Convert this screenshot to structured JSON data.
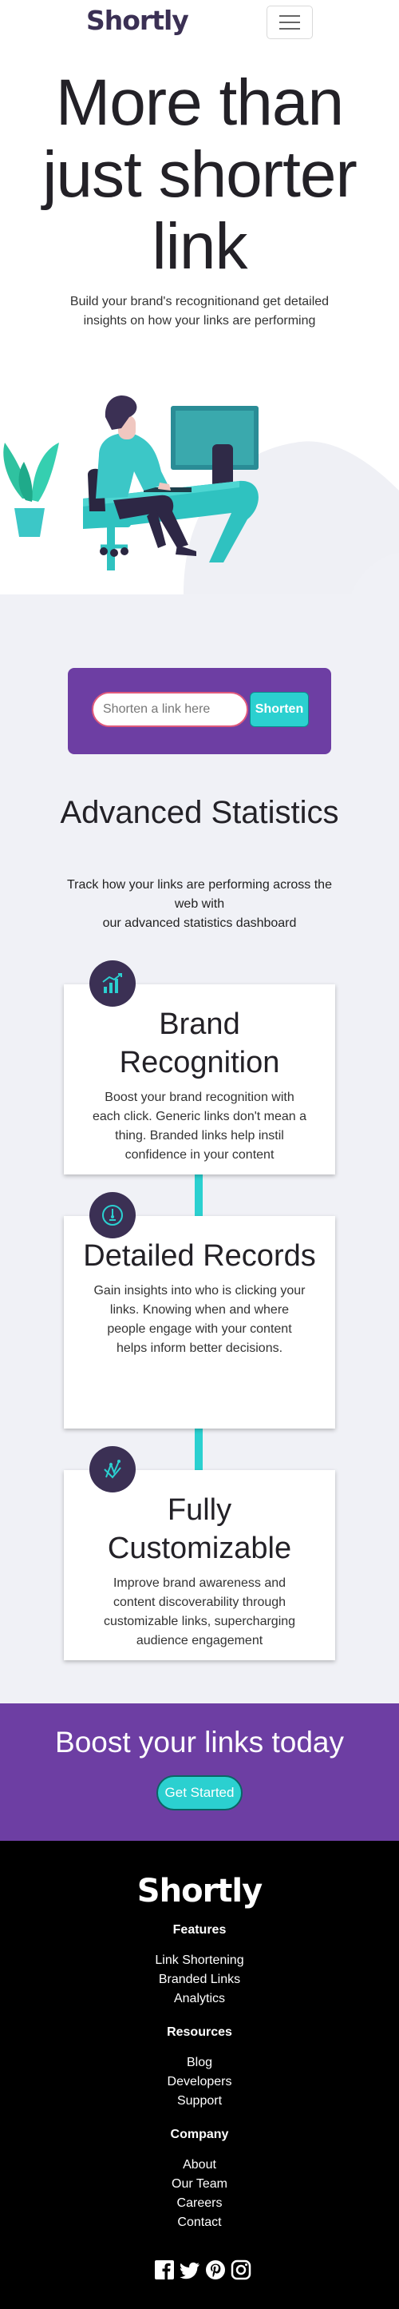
{
  "header": {
    "logo": "Shortly",
    "menu_icon": "hamburger-icon"
  },
  "hero": {
    "title": "More than just shorter link",
    "subtitle": "Build your brand's recognitionand get detailed insights on how your links are performing",
    "illustration": "person-working-at-desk-illustration"
  },
  "shorten": {
    "placeholder": "Shorten a link here",
    "button": "Shorten"
  },
  "stats": {
    "title": "Advanced Statistics",
    "subtitle_line1": "Track how your links are performing across the web with",
    "subtitle_line2": "our advanced statistics dashboard",
    "cards": [
      {
        "icon": "brand-recognition-icon",
        "title": "Brand Recognition",
        "text": "Boost your brand recognition with each click. Generic links don't mean a thing. Branded links help instil confidence in your content"
      },
      {
        "icon": "detailed-records-icon",
        "title": "Detailed Records",
        "text": "Gain insights into who is clicking your links. Knowing when and where people engage with your content helps inform better decisions."
      },
      {
        "icon": "fully-customizable-icon",
        "title": "Fully Customizable",
        "text": "Improve brand awareness and content discoverability through customizable links, supercharging audience engagement"
      }
    ]
  },
  "boost": {
    "title": "Boost your links today",
    "button": "Get Started"
  },
  "footer": {
    "logo": "Shortly",
    "sections": [
      {
        "heading": "Features",
        "links": [
          "Link Shortening",
          "Branded Links",
          "Analytics"
        ]
      },
      {
        "heading": "Resources",
        "links": [
          "Blog",
          "Developers",
          "Support"
        ]
      },
      {
        "heading": "Company",
        "links": [
          "About",
          "Our Team",
          "Careers",
          "Contact"
        ]
      }
    ],
    "socials": [
      "facebook-icon",
      "twitter-icon",
      "pinterest-icon",
      "instagram-icon"
    ]
  },
  "colors": {
    "primary_cyan": "#2bd0d0",
    "dark_violet": "#3b3054",
    "purple": "#6d3ea3",
    "grey_bg": "#f0f1f6",
    "footer_bg": "#000000"
  }
}
